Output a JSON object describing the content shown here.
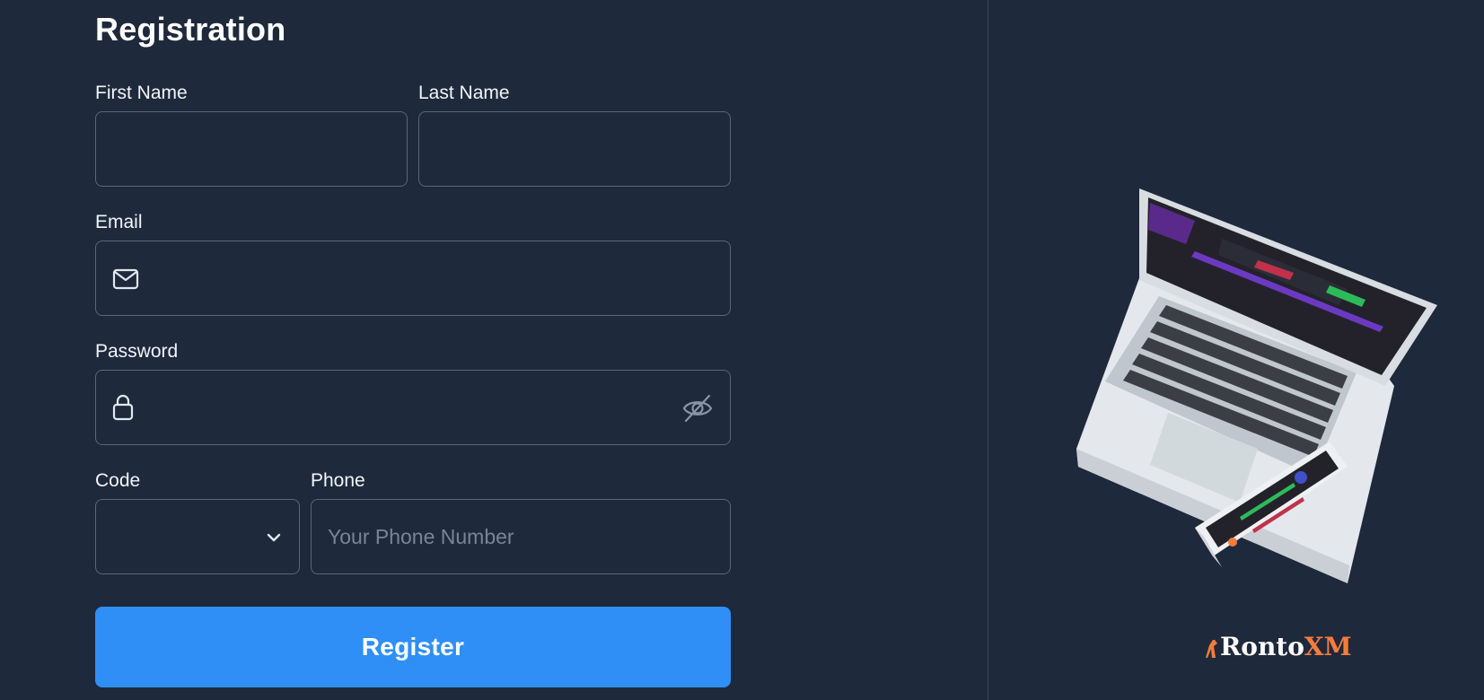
{
  "form": {
    "title": "Registration",
    "first_name_label": "First Name",
    "last_name_label": "Last Name",
    "email_label": "Email",
    "password_label": "Password",
    "code_label": "Code",
    "phone_label": "Phone",
    "first_name_value": "",
    "last_name_value": "",
    "email_value": "",
    "password_value": "",
    "code_value": "",
    "phone_value": "",
    "phone_placeholder": "Your Phone Number",
    "register_label": "Register"
  },
  "brand": {
    "logo_part1": "Ronto",
    "logo_part2": "XM",
    "accent_color": "#f47c3c"
  },
  "colors": {
    "background": "#1e293b",
    "button": "#2f8ff6",
    "border": "#5b6678"
  },
  "icons": {
    "email": "envelope-icon",
    "password": "lock-icon",
    "toggle_password": "eye-off-icon",
    "code_dropdown": "chevron-down-icon"
  }
}
